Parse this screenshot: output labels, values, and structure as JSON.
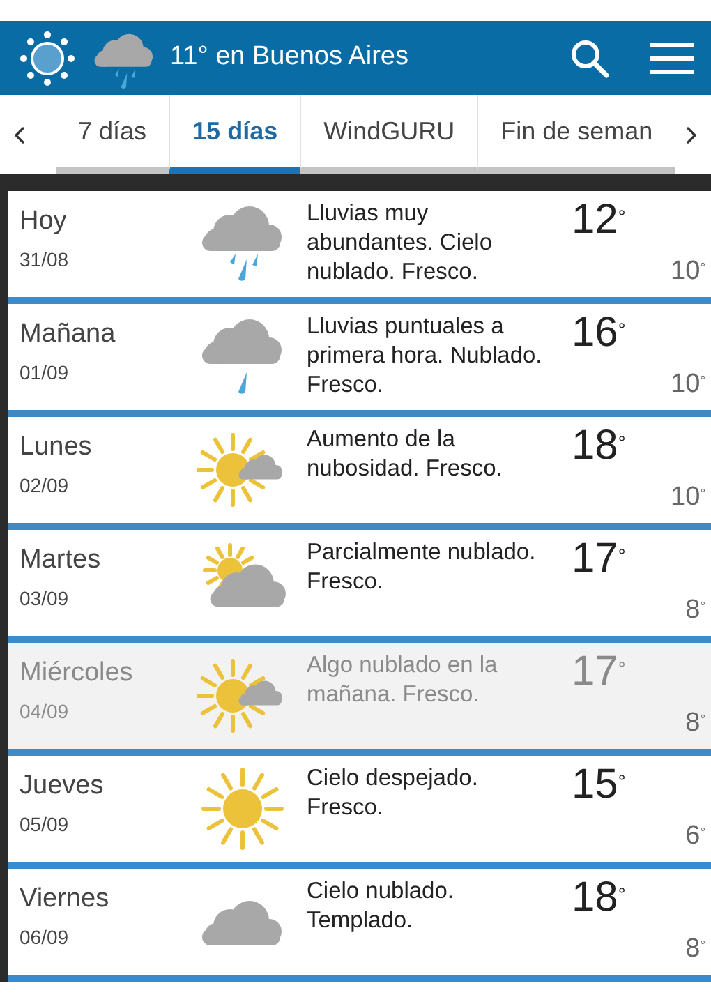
{
  "header": {
    "title": "11° en Buenos Aires"
  },
  "tabs": [
    {
      "label": "7 días",
      "selected": false
    },
    {
      "label": "15 días",
      "selected": true
    },
    {
      "label": "WindGURU",
      "selected": false
    },
    {
      "label": "Fin de seman",
      "selected": false
    }
  ],
  "days": [
    {
      "day": "Hoy",
      "date": "31/08",
      "kind": "rain_heavy",
      "description": "Lluvias muy abundantes. Cielo nublado. Fresco.",
      "high": "12$^{°}$",
      "low": "10$^{°}$",
      "selected": false
    },
    {
      "day": "Mañana",
      "date": "01/09",
      "kind": "rain",
      "description": "Lluvias puntuales a primera hora. Nublado. Fresco.",
      "high": "16$^{°}$",
      "low": "10$^{°}$",
      "selected": false
    },
    {
      "day": "Lunes",
      "date": "02/09",
      "kind": "sun_cloud",
      "description": "Aumento de la nubosidad. Fresco.",
      "high": "18$^{°}$",
      "low": "10$^{°}$",
      "selected": false
    },
    {
      "day": "Martes",
      "date": "03/09",
      "kind": "cloud_sun",
      "description": "Parcialmente nublado. Fresco.",
      "high": "17$^{°}$",
      "low": "8$^{°}$",
      "selected": false
    },
    {
      "day": "Miércoles",
      "date": "04/09",
      "kind": "sun_cloud",
      "description": "Algo nublado en la mañana. Fresco.",
      "high": "17$^{°}$",
      "low": "8$^{°}$",
      "selected": true
    },
    {
      "day": "Jueves",
      "date": "05/09",
      "kind": "sun",
      "description": "Cielo despejado. Fresco.",
      "high": "15$^{°}$",
      "low": "6$^{°}$",
      "selected": false
    },
    {
      "day": "Viernes",
      "date": "06/09",
      "kind": "cloud",
      "description": "Cielo nublado. Templado.",
      "high": "18$^{°}$",
      "low": "8$^{°}$",
      "selected": false
    }
  ]
}
